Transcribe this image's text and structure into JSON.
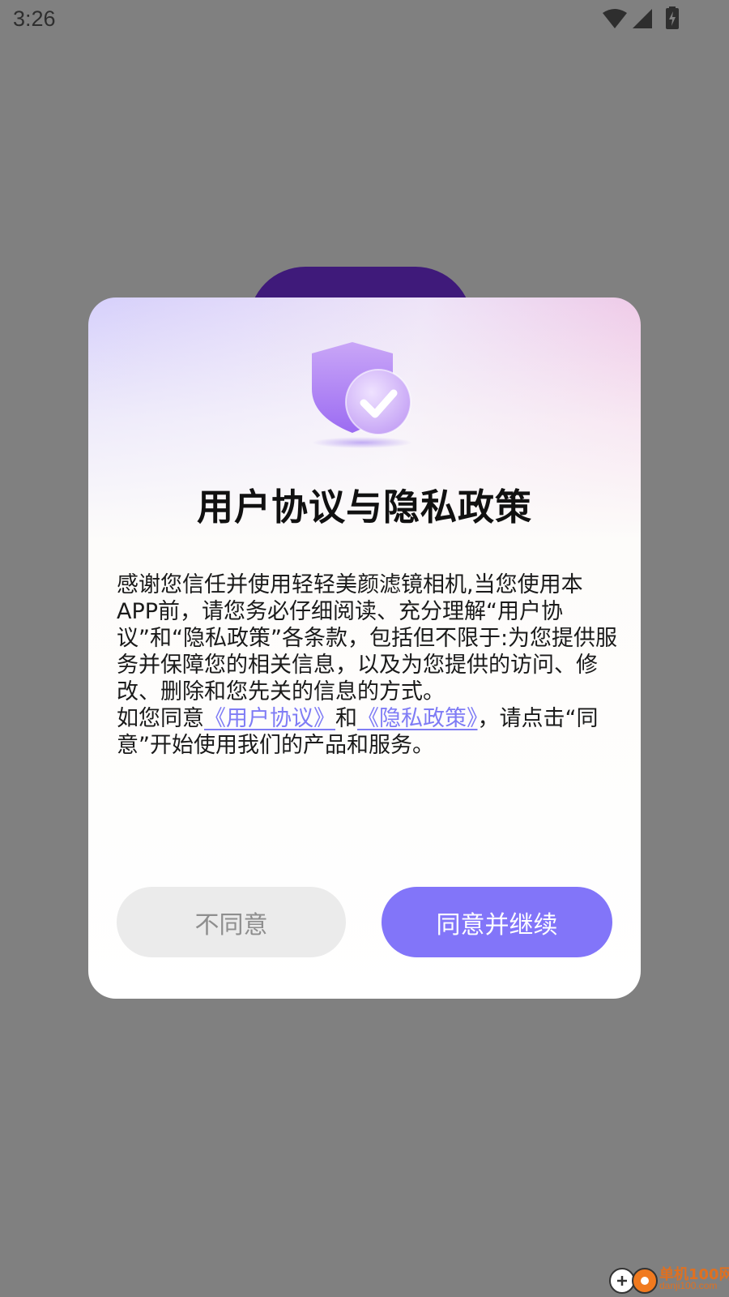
{
  "status_bar": {
    "time": "3:26"
  },
  "dialog": {
    "title": "用户协议与隐私政策",
    "body_paragraph_1": "感谢您信任并使用轻轻美颜滤镜相机,当您使用本APP前，请您务必仔细阅读、充分理解“用户协议”和“隐私政策”各条款，包括但不限于:为您提供服务并保障您的相关信息，以及为您提供的访问、修改、删除和您先关的信息的方式。",
    "body_p2_prefix": "如您同意",
    "link_user_agreement": "《用户协议》",
    "body_p2_and": "和",
    "link_privacy_policy": "《隐私政策》",
    "body_p2_suffix": "，请点击“同意”开始使用我们的产品和服务。",
    "disagree_label": "不同意",
    "agree_label": "同意并继续",
    "icon": "shield-check-icon"
  },
  "watermark": {
    "text": "单机100网",
    "url": "danji100.com"
  },
  "colors": {
    "overlay": "#808080",
    "accent": "#8275f9",
    "link": "#7f7cf5",
    "disagree_bg": "#ebebeb"
  }
}
